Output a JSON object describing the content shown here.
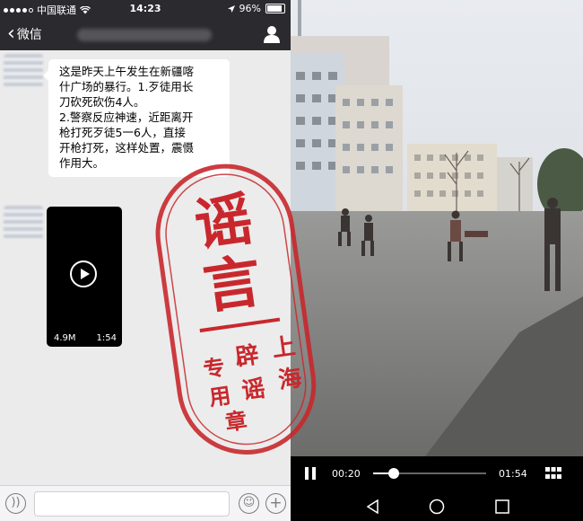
{
  "status_bar": {
    "carrier": "中国联通",
    "time": "14:23",
    "battery": "96%"
  },
  "nav": {
    "back_label": "微信"
  },
  "message": {
    "text_lines": [
      "这是昨天上午发生在新疆喀",
      "什广场的暴行。1.歹徒用长",
      "刀砍死砍伤4人。",
      "2.警察反应神速，近距离开",
      "枪打死歹徒5一6人，直接",
      "开枪打死，这样处置，震慑",
      "作用大。"
    ]
  },
  "video_message": {
    "size": "4.9M",
    "duration": "1:54"
  },
  "stamp": {
    "big_chars": [
      "谣",
      "言"
    ],
    "small_chars": [
      "上",
      "辟",
      "专",
      "海",
      "谣",
      "用",
      "章"
    ],
    "color": "#c8282d"
  },
  "player": {
    "current_time": "00:20",
    "total_time": "01:54",
    "progress": 0.18
  },
  "colors": {
    "header": "#2b2b2f",
    "chat_bg": "#ebebeb",
    "stamp": "#c8282d"
  },
  "icons": [
    "wifi-icon",
    "chevron-left-icon",
    "person-icon",
    "play-icon",
    "voice-icon",
    "emoji-icon",
    "plus-icon",
    "pause-icon",
    "grid-icon",
    "android-back-icon",
    "android-home-icon",
    "android-recents-icon"
  ]
}
